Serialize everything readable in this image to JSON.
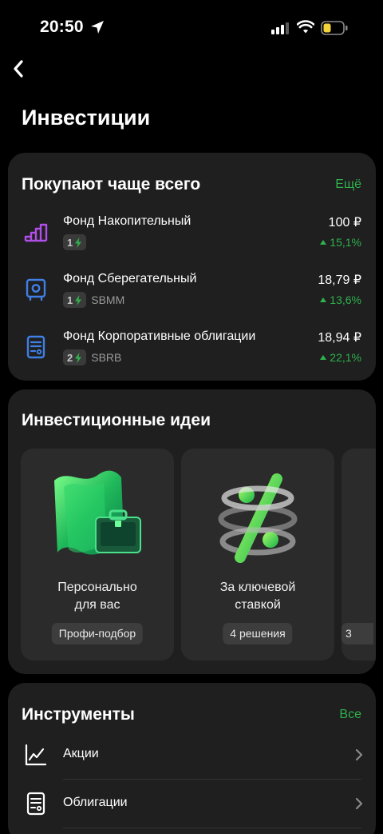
{
  "status_bar": {
    "time": "20:50"
  },
  "header": {
    "title": "Инвестиции"
  },
  "popular": {
    "title": "Покупают чаще всего",
    "more_link": "Ещё",
    "funds": [
      {
        "name": "Фонд Накопительный",
        "risk": "1",
        "ticker": "",
        "price": "100 ₽",
        "change": "15,1%",
        "icon": "bar-chart-icon"
      },
      {
        "name": "Фонд Сберегательный",
        "risk": "1",
        "ticker": "SBMM",
        "price": "18,79 ₽",
        "change": "13,6%",
        "icon": "safe-icon"
      },
      {
        "name": "Фонд Корпоративные облигации",
        "risk": "2",
        "ticker": "SBRB",
        "price": "18,94 ₽",
        "change": "22,1%",
        "icon": "bond-document-icon"
      }
    ]
  },
  "ideas": {
    "title": "Инвестиционные идеи",
    "cards": [
      {
        "title_line1": "Персонально",
        "title_line2": "для вас",
        "tag": "Профи-подбор",
        "art": "money-and-briefcase-illustration"
      },
      {
        "title_line1": "За ключевой",
        "title_line2": "ставкой",
        "tag": "4 решения",
        "art": "percent-spiral-illustration"
      },
      {
        "tag": "3"
      }
    ]
  },
  "instruments": {
    "title": "Инструменты",
    "all_link": "Все",
    "items": [
      {
        "label": "Акции",
        "icon": "stock-chart-icon"
      },
      {
        "label": "Облигации",
        "icon": "bond-document-icon"
      }
    ]
  },
  "colors": {
    "accent": "#2fb14d",
    "card_bg": "#1f1f1f",
    "page_bg": "#000000"
  }
}
